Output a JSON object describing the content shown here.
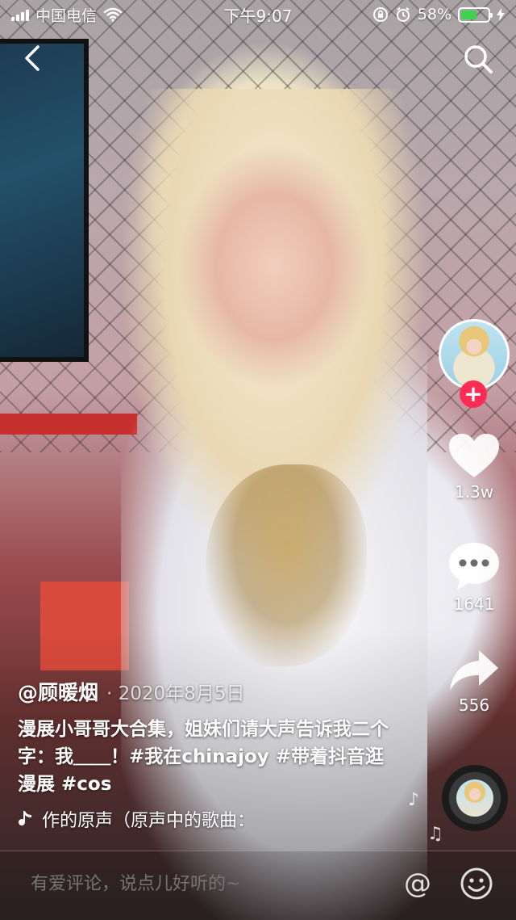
{
  "status_bar": {
    "carrier": "中国电信",
    "time": "下午9:07",
    "battery": "58%",
    "battery_level": 0.58
  },
  "nav": {
    "back_icon": "chevron-left-icon",
    "search_icon": "search-icon"
  },
  "rail": {
    "follow_label": "+",
    "likes": "1.3w",
    "comments": "1641",
    "shares": "556"
  },
  "post": {
    "author": "@顾暖烟",
    "date": "· 2020年8月5日",
    "caption": "漫展小哥哥大合集，姐妹们请大声告诉我二个字：我＿＿！#我在chinajoy #带着抖音逛漫展 #cos",
    "music": "作的原声（原声中的歌曲："
  },
  "comment_bar": {
    "placeholder": "有爱评论，说点儿好听的~",
    "at_label": "@"
  },
  "colors": {
    "accent": "#fe2c55",
    "battery": "#3fd24f"
  }
}
